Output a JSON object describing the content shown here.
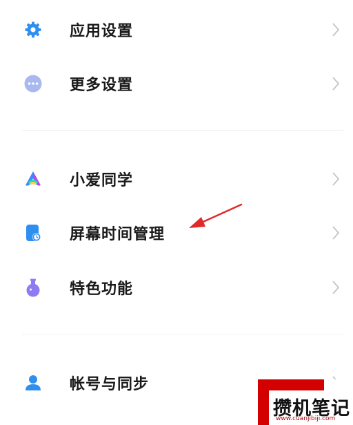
{
  "colors": {
    "accent": "#2f8ff0",
    "arrow": "#e02a2a",
    "watermark_red": "#d40000"
  },
  "settings": {
    "items": [
      {
        "label": "应用设置",
        "icon": "gear-icon"
      },
      {
        "label": "更多设置",
        "icon": "more-dots-icon"
      },
      {
        "label": "小爱同学",
        "icon": "xiaoai-logo-icon"
      },
      {
        "label": "屏幕时间管理",
        "icon": "screen-time-icon"
      },
      {
        "label": "特色功能",
        "icon": "flask-icon"
      },
      {
        "label": "帐号与同步",
        "icon": "person-icon"
      }
    ]
  },
  "watermark": {
    "title": "攒机笔记",
    "url": "www.cuanjibiji.com"
  }
}
